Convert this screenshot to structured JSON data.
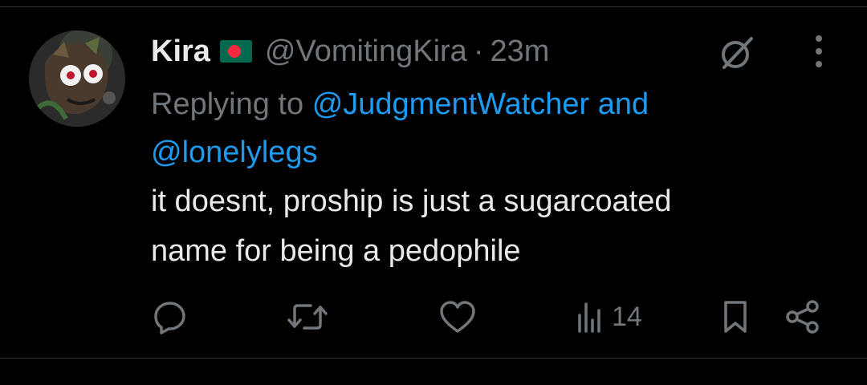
{
  "tweet": {
    "display_name": "Kira",
    "flag_icon": "bangladesh-flag-icon",
    "handle": "@VomitingKira",
    "separator": "·",
    "time": "23m",
    "replying_to_prefix": "Replying to",
    "mention_1": "@JudgmentWatcher",
    "connector": "and",
    "mention_2": "@lonelylegs",
    "text_line_1": "it doesnt, proship is just a sugarcoated",
    "text_line_2": "name for being a pedophile"
  },
  "actions": {
    "reply_icon": "reply-icon",
    "retweet_icon": "retweet-icon",
    "like_icon": "heart-icon",
    "views_icon": "views-icon",
    "views_count": "14",
    "bookmark_icon": "bookmark-icon",
    "share_icon": "share-icon"
  },
  "colors": {
    "background": "#000000",
    "text_primary": "#e7e9ea",
    "text_secondary": "#71767b",
    "accent": "#1d9bf0",
    "flag_green": "#006a4e",
    "flag_red": "#f42a41"
  }
}
